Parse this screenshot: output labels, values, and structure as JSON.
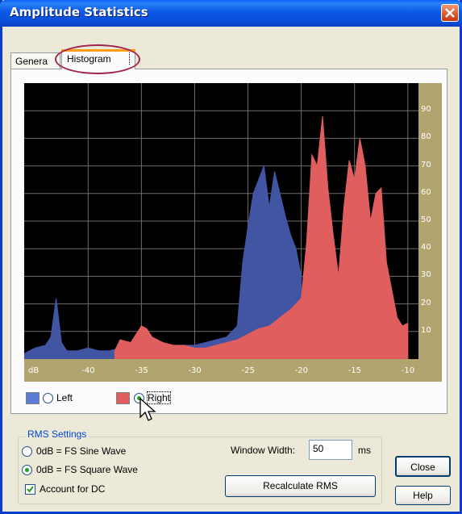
{
  "window": {
    "title": "Amplitude Statistics"
  },
  "tabs": [
    {
      "label": "Genera"
    },
    {
      "label": "Histogram"
    }
  ],
  "chart_data": {
    "type": "area",
    "xlabel": "dB",
    "x_ticks": [
      -40,
      -35,
      -30,
      -25,
      -20,
      -15,
      -10
    ],
    "y_ticks": [
      10,
      20,
      30,
      40,
      50,
      60,
      70,
      80,
      90
    ],
    "xlim": [
      -46,
      -9
    ],
    "ylim": [
      0,
      100
    ],
    "series": [
      {
        "name": "Left",
        "color": "#4155a3",
        "x": [
          -46,
          -45,
          -44,
          -43.5,
          -43,
          -42.5,
          -42,
          -41,
          -40,
          -39,
          -38,
          -37,
          -36,
          -35,
          -34,
          -33,
          -32,
          -31,
          -30,
          -29,
          -28,
          -27,
          -26,
          -25.5,
          -25,
          -24.5,
          -24,
          -23.5,
          -23,
          -22.5,
          -22,
          -21.5,
          -21,
          -20.5,
          -20
        ],
        "values": [
          2,
          4,
          5,
          8,
          22,
          6,
          3,
          3,
          4,
          3,
          3,
          4,
          5,
          9,
          5,
          4,
          4,
          5,
          5,
          6,
          7,
          8,
          12,
          35,
          48,
          60,
          65,
          70,
          55,
          68,
          60,
          52,
          45,
          40,
          30
        ]
      },
      {
        "name": "Right",
        "color": "#e05e5e",
        "x": [
          -37.5,
          -37,
          -36,
          -35.5,
          -35,
          -34.5,
          -34,
          -33,
          -32,
          -31,
          -30,
          -29,
          -28,
          -27,
          -26,
          -25,
          -24,
          -23,
          -22,
          -21,
          -20,
          -19.5,
          -19,
          -18.5,
          -18,
          -17.5,
          -17,
          -16.5,
          -16,
          -15.5,
          -15,
          -14.5,
          -14,
          -13.5,
          -13,
          -12.5,
          -12,
          -11.5,
          -11,
          -10.5,
          -10
        ],
        "values": [
          3,
          7,
          6,
          9,
          12,
          11,
          8,
          6,
          5,
          5,
          4,
          4,
          5,
          6,
          7,
          9,
          11,
          12,
          15,
          18,
          22,
          42,
          74,
          70,
          88,
          62,
          45,
          30,
          55,
          72,
          65,
          80,
          70,
          50,
          60,
          62,
          35,
          25,
          15,
          12,
          13
        ]
      }
    ]
  },
  "legend": {
    "left_label": "Left",
    "right_label": "Right",
    "left_color": "#5a7ad6",
    "right_color": "#e05e5e"
  },
  "rms": {
    "group_label": "RMS Settings",
    "sine_label": "0dB = FS Sine Wave",
    "square_label": "0dB = FS Square Wave",
    "dc_label": "Account for DC",
    "window_width_label": "Window Width:",
    "window_width_value": "50",
    "window_width_unit": "ms",
    "recalculate_label": "Recalculate RMS"
  },
  "buttons": {
    "close": "Close",
    "help": "Help"
  }
}
